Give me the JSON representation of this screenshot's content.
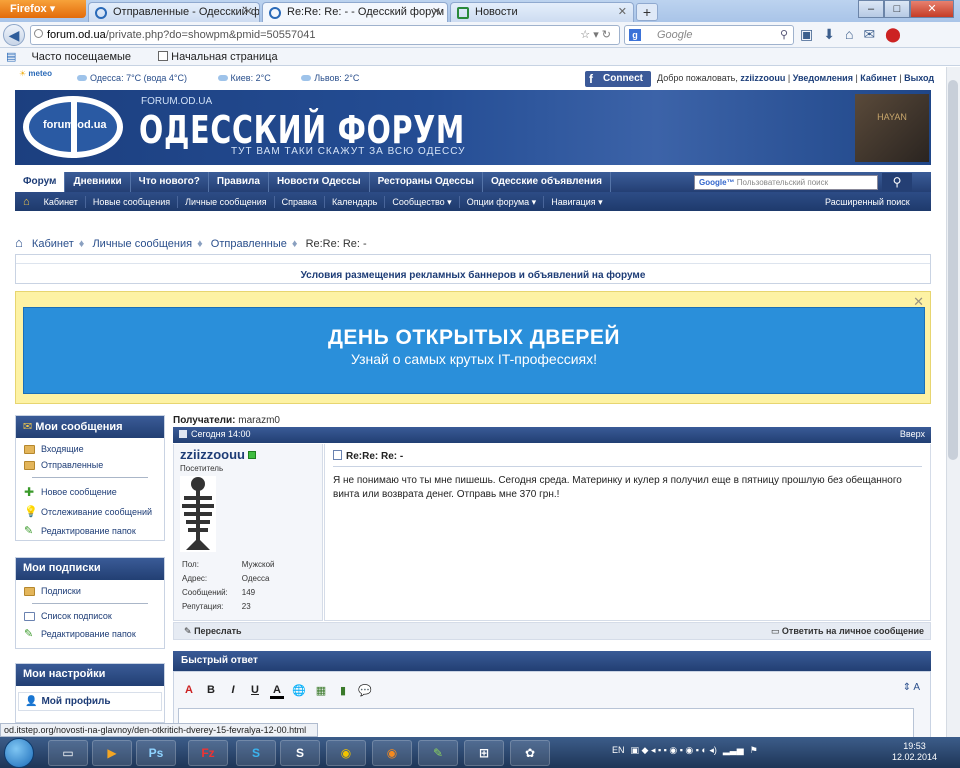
{
  "browser": {
    "app_button": "Firefox",
    "tabs": [
      {
        "label": "Отправленные - Одесский форум",
        "active": false
      },
      {
        "label": "Re:Re: Re: - - Одесский форум",
        "active": true
      },
      {
        "label": "Новости",
        "active": false
      }
    ],
    "url_prefix": "forum.od.ua",
    "url_rest": "/private.php?do=showpm&pmid=50557041",
    "search_placeholder": "Google",
    "search_badge": "g",
    "bookmarks": [
      "Часто посещаемые",
      "Начальная страница"
    ]
  },
  "topstrip": {
    "weather": [
      "Одесса: 7°C (вода 4°C)",
      "Киев: 2°C",
      "Львов: 2°C"
    ],
    "weather_logo": "meteo",
    "fb_connect": "Connect",
    "welcome": "Добро пожаловать,",
    "username": "zziizzoouu",
    "links": [
      "Уведомления",
      "Кабинет",
      "Выход"
    ]
  },
  "banner": {
    "logo_text": "forum.od.ua",
    "site_url": "FORUM.OD.UA",
    "site_name": "ОДЕССКИЙ ФОРУМ",
    "slogan": "ТУТ ВАМ ТАКИ СКАЖУТ ЗА ВСЮ ОДЕССУ",
    "album_text": "HAYAN"
  },
  "menu_main": [
    "Форум",
    "Дневники",
    "Что нового?",
    "Правила",
    "Новости Одессы",
    "Рестораны Одессы",
    "Одесские объявления"
  ],
  "search": {
    "brand": "Google™",
    "placeholder": "Пользовательский поиск"
  },
  "menu_sub": [
    "Кабинет",
    "Новые сообщения",
    "Личные сообщения",
    "Справка",
    "Календарь",
    "Сообщество ▾",
    "Опции форума ▾",
    "Навигация ▾"
  ],
  "advanced_search": "Расширенный поиск",
  "breadcrumb": [
    "Кабинет",
    "Личные сообщения",
    "Отправленные"
  ],
  "breadcrumb_current": "Re:Re: Re: -",
  "rules_link": "Условия размещения рекламных баннеров и объявлений на форуме",
  "promo": {
    "headline": "ДЕНЬ ОТКРЫТЫХ ДВЕРЕЙ",
    "subline": "Узнай о самых крутых IT-профессиях!"
  },
  "sidebar": {
    "messages_title": "Мои сообщения",
    "folders": [
      "Входящие",
      "Отправленные"
    ],
    "actions": [
      "Новое сообщение",
      "Отслеживание сообщений",
      "Редактирование папок"
    ],
    "subs_title": "Мои подписки",
    "subs_folders": [
      "Подписки"
    ],
    "subs_actions": [
      "Список подписок",
      "Редактирование папок"
    ],
    "settings_title": "Мои настройки",
    "profile": "Мой профиль"
  },
  "post": {
    "recipients_label": "Получатели:",
    "recipient": "marazm0",
    "date": "Сегодня 14:00",
    "top_link": "Вверх",
    "username": "zziizzoouu",
    "user_title": "Посетитель",
    "stats": [
      {
        "k": "Пол:",
        "v": "Мужской"
      },
      {
        "k": "Адрес:",
        "v": "Одесса"
      },
      {
        "k": "Сообщений:",
        "v": "149"
      },
      {
        "k": "Репутация:",
        "v": "23"
      }
    ],
    "title": "Re:Re: Re: -",
    "body": "Я не понимаю что ты мне пишешь. Сегодня среда. Материнку и кулер я получил еще в пятницу прошлую без обещанного винта или возврата денег. Отправь мне 370 грн.!",
    "forward": "Переслать",
    "reply": "Ответить на личное сообщение"
  },
  "quick_reply": {
    "title": "Быстрый ответ"
  },
  "statusbar": "od.itstep.org/novosti-na-glavnoy/den-otkritich-dverey-15-fevralya-12-00.html",
  "taskbar": {
    "lang": "EN",
    "time": "19:53",
    "date": "12.02.2014"
  }
}
